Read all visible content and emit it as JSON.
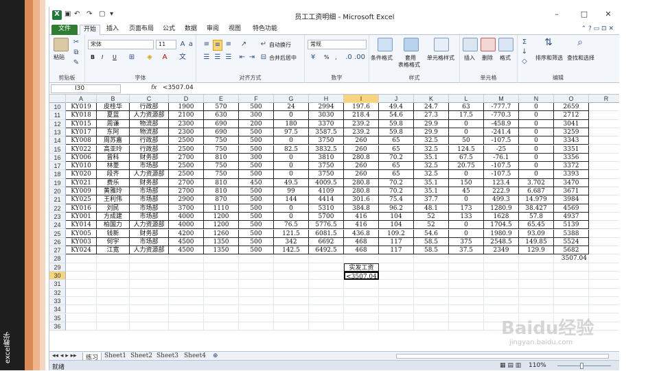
{
  "side_caption": "excel教学",
  "window": {
    "title": "员工工资明细 - Microsoft Excel",
    "minimize": "–",
    "restore": "□",
    "close": "✕"
  },
  "tabs": [
    "文件",
    "开始",
    "插入",
    "页面布局",
    "公式",
    "数据",
    "审阅",
    "视图",
    "特色功能"
  ],
  "ribbon": {
    "paste": "粘贴",
    "clipboard": "剪贴板",
    "font_name": "宋体",
    "font_size": "11",
    "bold": "B",
    "italic": "I",
    "underline": "U",
    "font_group": "字体",
    "wrap_text": "自动换行",
    "merge_center": "合并后居中",
    "align_group": "对齐方式",
    "number_format": "常规",
    "percent": "%",
    "comma": ",",
    "number_group": "数字",
    "cond_format": "条件格式",
    "table_format": "套用\n表格格式",
    "table_format_l1": "套用",
    "table_format_l2": "表格格式",
    "cell_style": "单元格样式",
    "styles_group": "样式",
    "insert": "插入",
    "delete": "删除",
    "format": "格式",
    "cells_group": "单元格",
    "sort_filter": "排序和筛选",
    "find_select": "查找和选择",
    "edit_group": "编辑"
  },
  "formula_bar": {
    "name_box": "I30",
    "fx": "fx",
    "formula": "<3507.04"
  },
  "columns": [
    "A",
    "B",
    "C",
    "D",
    "E",
    "F",
    "G",
    "H",
    "I",
    "J",
    "K",
    "L",
    "M",
    "N",
    "O",
    "R"
  ],
  "selected_column": "I",
  "rows": [
    {
      "n": "10",
      "c": [
        "KY019",
        "皮桂华",
        "行政部",
        "1900",
        "570",
        "500",
        "24",
        "2994",
        "197.6",
        "49.4",
        "24.7",
        "63",
        "-777.7",
        "0",
        "2659"
      ]
    },
    {
      "n": "11",
      "c": [
        "KY018",
        "夏蓝",
        "人力资源部",
        "2100",
        "630",
        "300",
        "0",
        "3030",
        "218.4",
        "54.6",
        "27.3",
        "17.5",
        "-770.3",
        "0",
        "2712"
      ]
    },
    {
      "n": "12",
      "c": [
        "KY015",
        "周谦",
        "物流部",
        "2300",
        "690",
        "200",
        "180",
        "3370",
        "239.2",
        "59.8",
        "29.9",
        "0",
        "-458.9",
        "0",
        "3041"
      ]
    },
    {
      "n": "13",
      "c": [
        "KY017",
        "东阿",
        "物流部",
        "2300",
        "690",
        "500",
        "97.5",
        "3587.5",
        "239.2",
        "59.8",
        "29.9",
        "0",
        "-241.4",
        "0",
        "3259"
      ]
    },
    {
      "n": "14",
      "c": [
        "KY008",
        "周苏嘉",
        "行政部",
        "2500",
        "750",
        "500",
        "0",
        "3750",
        "260",
        "65",
        "32.5",
        "50",
        "-107.5",
        "0",
        "3343"
      ]
    },
    {
      "n": "15",
      "c": [
        "KY022",
        "高亚玲",
        "行政部",
        "2500",
        "750",
        "500",
        "82.5",
        "3832.5",
        "260",
        "65",
        "32.5",
        "124.5",
        "-25",
        "0",
        "3351"
      ]
    },
    {
      "n": "16",
      "c": [
        "KY006",
        "曾科",
        "财务部",
        "2700",
        "810",
        "300",
        "0",
        "3810",
        "280.8",
        "70.2",
        "35.1",
        "67.5",
        "-76.1",
        "0",
        "3356"
      ]
    },
    {
      "n": "17",
      "c": [
        "KY010",
        "林菱",
        "市场部",
        "2500",
        "750",
        "500",
        "0",
        "3750",
        "260",
        "65",
        "32.5",
        "20.75",
        "-107.5",
        "0",
        "3372"
      ]
    },
    {
      "n": "18",
      "c": [
        "KY020",
        "段齐",
        "人力资源部",
        "2500",
        "750",
        "500",
        "0",
        "3750",
        "260",
        "65",
        "32.5",
        "0",
        "-107.5",
        "0",
        "3393"
      ]
    },
    {
      "n": "19",
      "c": [
        "KY021",
        "费乐",
        "财务部",
        "2700",
        "810",
        "450",
        "49.5",
        "4009.5",
        "280.8",
        "70.2",
        "35.1",
        "150",
        "123.4",
        "3.702",
        "3470"
      ]
    },
    {
      "n": "20",
      "c": [
        "KY009",
        "黄雅玲",
        "市场部",
        "2700",
        "810",
        "500",
        "99",
        "4109",
        "280.8",
        "70.2",
        "35.1",
        "45",
        "222.9",
        "6.687",
        "3671"
      ]
    },
    {
      "n": "21",
      "c": [
        "KY025",
        "王利伟",
        "市场部",
        "2900",
        "870",
        "500",
        "144",
        "4414",
        "301.6",
        "75.4",
        "37.7",
        "0",
        "499.3",
        "14.979",
        "3984"
      ]
    },
    {
      "n": "22",
      "c": [
        "KY016",
        "刘民",
        "市场部",
        "3700",
        "1110",
        "500",
        "0",
        "5310",
        "384.8",
        "96.2",
        "48.1",
        "173",
        "1280.9",
        "38.427",
        "4569"
      ]
    },
    {
      "n": "23",
      "c": [
        "KY001",
        "方成建",
        "市场部",
        "4000",
        "1200",
        "500",
        "0",
        "5700",
        "416",
        "104",
        "52",
        "133",
        "1628",
        "57.8",
        "4937"
      ]
    },
    {
      "n": "24",
      "c": [
        "KY014",
        "柏国力",
        "人力资源部",
        "4000",
        "1200",
        "500",
        "76.5",
        "5776.5",
        "416",
        "104",
        "52",
        "0",
        "1704.5",
        "65.45",
        "5139"
      ]
    },
    {
      "n": "25",
      "c": [
        "KY005",
        "钱新",
        "财务部",
        "4200",
        "1260",
        "500",
        "121.5",
        "6081.5",
        "436.8",
        "109.2",
        "54.6",
        "0",
        "1980.9",
        "93.09",
        "5388"
      ]
    },
    {
      "n": "26",
      "c": [
        "KY003",
        "何宇",
        "市场部",
        "4500",
        "1350",
        "500",
        "342",
        "6692",
        "468",
        "117",
        "58.5",
        "375",
        "2548.5",
        "149.85",
        "5524"
      ]
    },
    {
      "n": "27",
      "c": [
        "KY024",
        "江宽",
        "人力资源部",
        "4500",
        "1350",
        "500",
        "142.5",
        "6492.5",
        "468",
        "117",
        "58.5",
        "37.5",
        "2349",
        "129.9",
        "5682"
      ]
    }
  ],
  "total_row": {
    "n": "28",
    "value": "3507.04"
  },
  "criteria_header": {
    "n": "29",
    "value": "实发工资"
  },
  "criteria_value": {
    "n": "30",
    "value": "<3507.04"
  },
  "empty_rows": [
    "31",
    "32",
    "33",
    "34",
    "35",
    "36"
  ],
  "sheets": [
    "练习",
    "Sheet1",
    "Sheet2",
    "Sheet3",
    "Sheet4"
  ],
  "status": {
    "ready": "就绪",
    "zoom": "110%"
  },
  "watermark": {
    "brand": "Baidu经验",
    "url": "jingyan.baidu.com"
  }
}
